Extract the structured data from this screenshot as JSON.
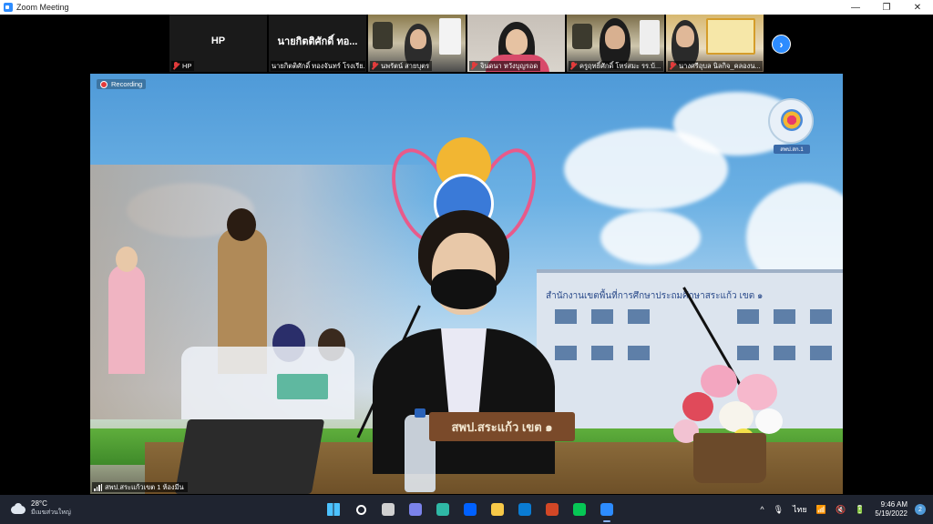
{
  "window": {
    "title": "Zoom Meeting",
    "minimize_glyph": "—",
    "restore_glyph": "❐",
    "close_glyph": "✕"
  },
  "participants": [
    {
      "display_name": "HP",
      "label": "HP",
      "muted": true,
      "video": false
    },
    {
      "display_name": "นายกิตติศักดิ์ ทอ...",
      "label": "นายกิตติศักดิ์ ทองจันทร์ โรงเรีย...",
      "muted": false,
      "video": false
    },
    {
      "label": "นพรัตน์ สายบุตร",
      "muted": true,
      "video": true
    },
    {
      "label": "จินดนา หวังบุญรอด",
      "muted": true,
      "video": true
    },
    {
      "label": "ครูฤทธิ์ศักดิ์ โหร่สมะ รร.บ้...",
      "muted": true,
      "video": true
    },
    {
      "label": "นางศรีอุบล นิลกิจ_คลองน...",
      "muted": true,
      "video": true
    }
  ],
  "next_page_glyph": "›",
  "main_video": {
    "recording_label": "Recording",
    "speaker_label": "สพป.สระแก้วเขต 1 ห้องมีน",
    "nameplate_text": "สพป.สระแก้ว เขต ๑",
    "building_sign": "สำนักงานเขตพื้นที่การศึกษาประถมศึกษาสระแก้ว เขต ๑",
    "badge_text": "สพป.สก.1"
  },
  "taskbar": {
    "weather_temp": "28°C",
    "weather_desc": "มีเมฆส่วนใหญ่",
    "apps": [
      {
        "icon": "windows-start-icon",
        "color": "#4cc2ff"
      },
      {
        "icon": "search-icon",
        "color": "#ffffff"
      },
      {
        "icon": "task-view-icon",
        "color": "#d0d0d0"
      },
      {
        "icon": "chat-icon",
        "color": "#7b83eb"
      },
      {
        "icon": "edge-icon",
        "color": "#2fb8a6"
      },
      {
        "icon": "dropbox-icon",
        "color": "#0061ff"
      },
      {
        "icon": "file-explorer-icon",
        "color": "#f7c948"
      },
      {
        "icon": "mail-icon",
        "color": "#0a7cd4"
      },
      {
        "icon": "powerpoint-icon",
        "color": "#d24726"
      },
      {
        "icon": "line-icon",
        "color": "#06c755"
      },
      {
        "icon": "zoom-icon",
        "color": "#2d8cff"
      }
    ],
    "tray_chevron": "^",
    "language": "ไทย",
    "time": "9:46 AM",
    "date": "5/19/2022",
    "notification_count": "2"
  }
}
